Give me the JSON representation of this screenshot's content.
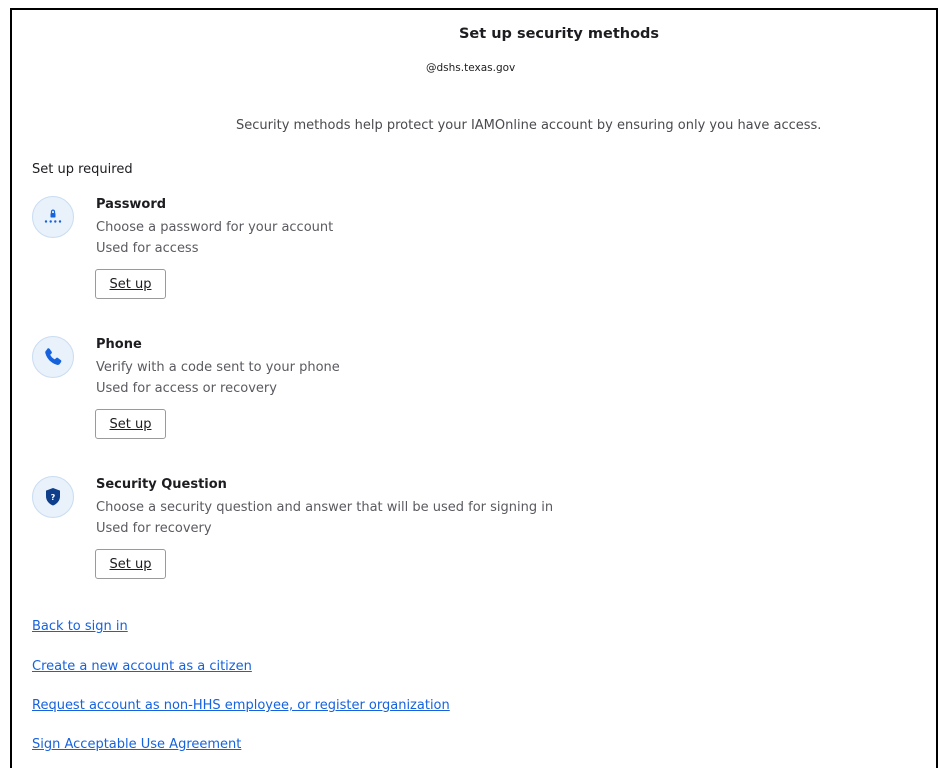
{
  "header": {
    "title": "Set up security methods",
    "email": "@dshs.texas.gov",
    "subtitle": "Security methods help protect your IAMOnline account by ensuring only you have access."
  },
  "section": {
    "heading": "Set up required"
  },
  "methods": [
    {
      "name": "Password",
      "description": "Choose a password for your account",
      "usage": "Used for access",
      "button_label": "Set up",
      "icon": "password-icon"
    },
    {
      "name": "Phone",
      "description": "Verify with a code sent to your phone",
      "usage": "Used for access or recovery",
      "button_label": "Set up",
      "icon": "phone-icon"
    },
    {
      "name": "Security Question",
      "description": "Choose a security question and answer that will be used for signing in",
      "usage": "Used for recovery",
      "button_label": "Set up",
      "icon": "security-question-icon"
    }
  ],
  "links": {
    "back_to_sign_in": "Back to sign in",
    "create_account": "Create a new account as a citizen",
    "request_account": "Request account as non-HHS employee, or register organization",
    "sign_agreement": "Sign Acceptable Use Agreement"
  },
  "colors": {
    "link": "#1662dd",
    "icon_background": "#e9f1fb",
    "icon_accent": "#1662dd"
  }
}
